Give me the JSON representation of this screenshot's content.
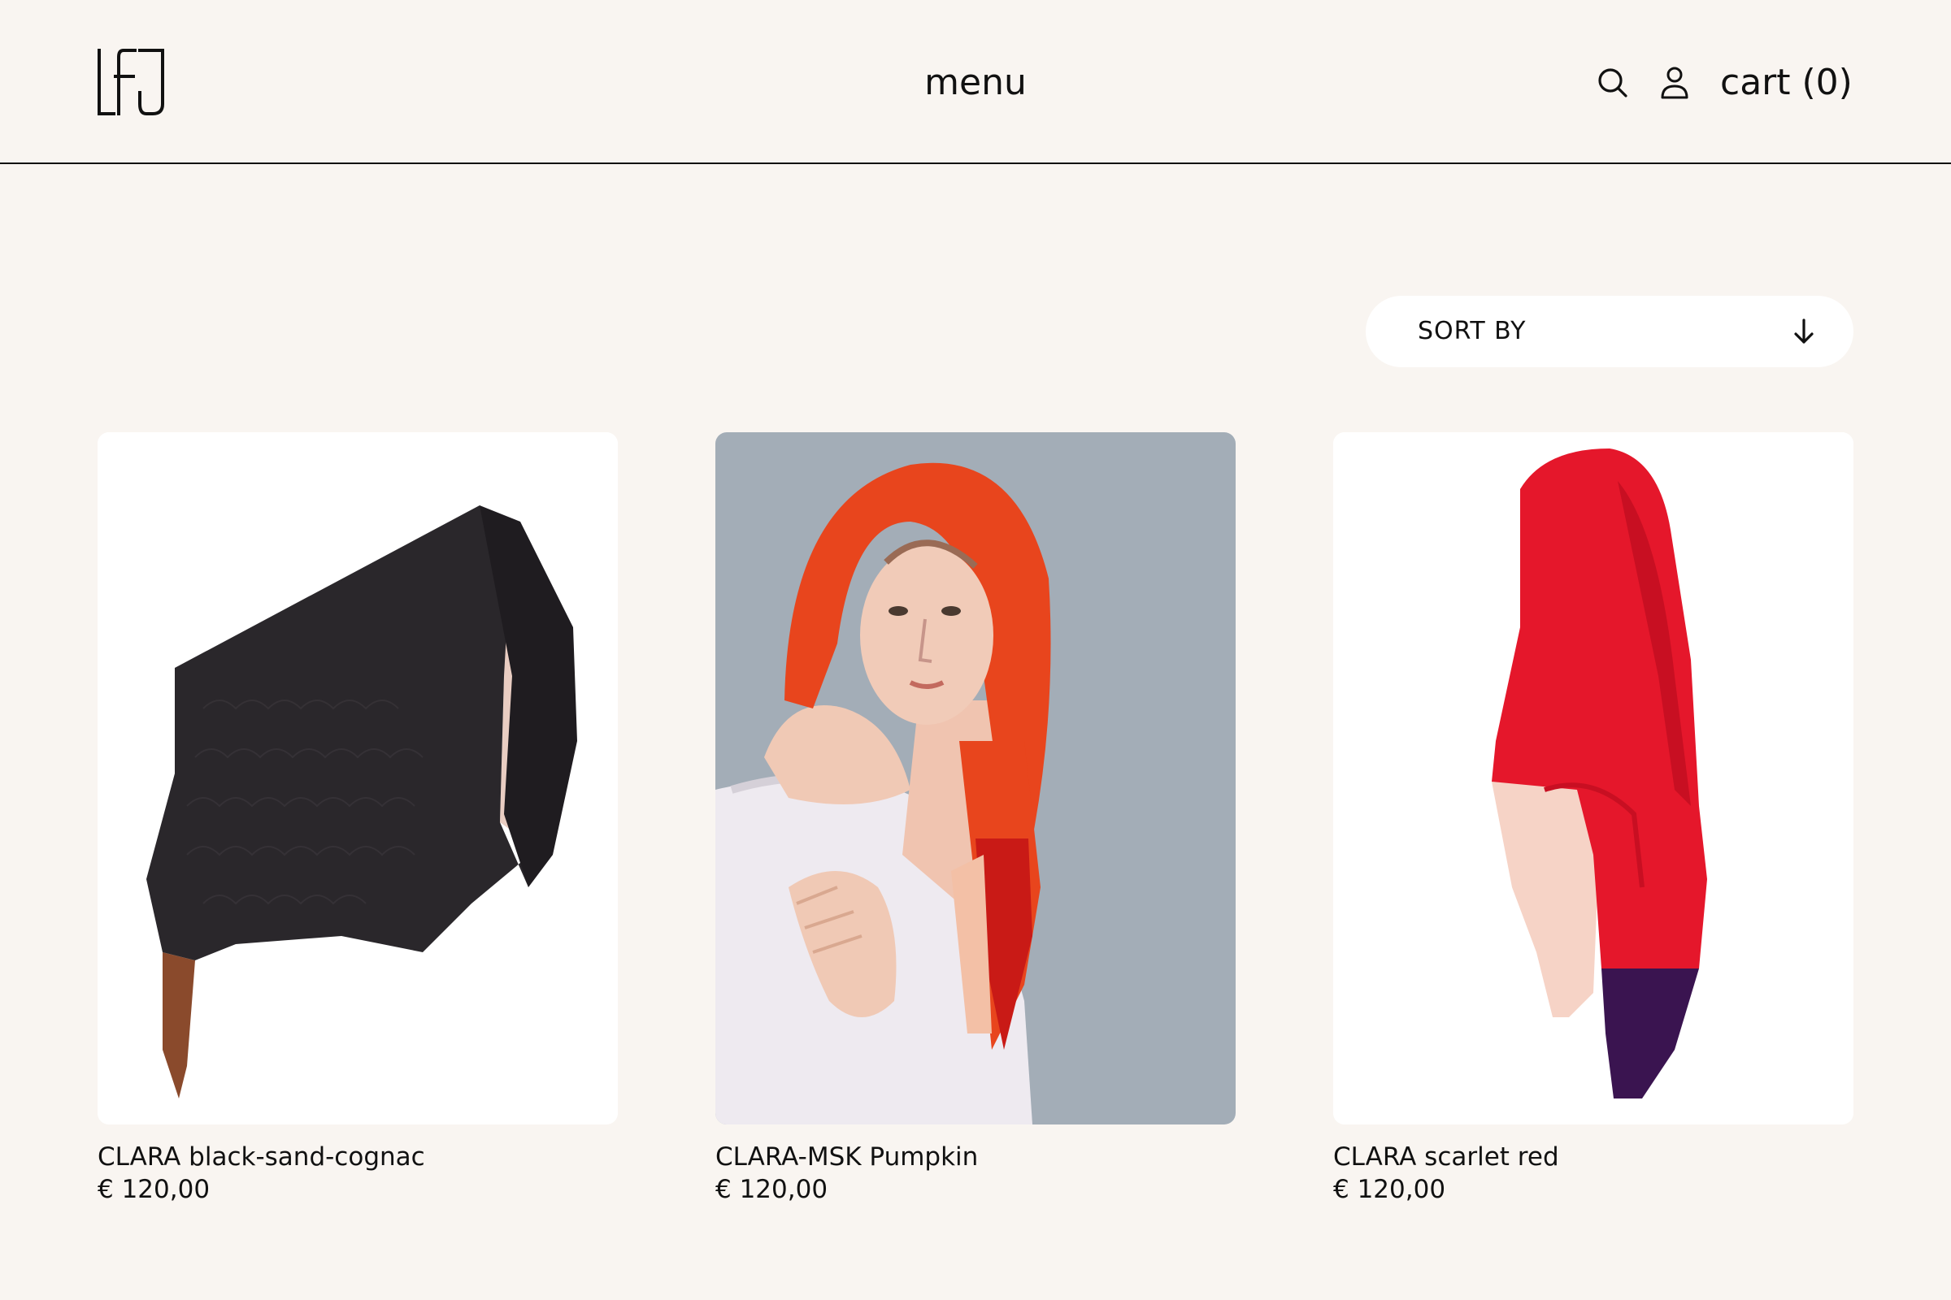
{
  "header": {
    "logo_text": "LFJ",
    "menu_label": "menu",
    "search_icon": "search-icon",
    "account_icon": "user-icon",
    "cart_label": "cart (0)"
  },
  "sort": {
    "label": "SORT BY",
    "icon": "arrow-down-icon"
  },
  "products": [
    {
      "name": "CLARA black-sand-cognac",
      "price": "€ 120,00",
      "image": "black shawl with sand and cognac panels hanging on wall"
    },
    {
      "name": "CLARA-MSK Pumpkin",
      "price": "€ 120,00",
      "image": "model wearing pumpkin orange knitted headscarf"
    },
    {
      "name": "CLARA scarlet red",
      "price": "€ 120,00",
      "image": "scarlet red shawl with pale pink and purple panels hanging on wall"
    }
  ],
  "colors": {
    "background": "#f9f5f1",
    "text": "#111111",
    "black_shawl": "#2a272b",
    "pumpkin": "#e8451d",
    "scarlet": "#e5172b"
  }
}
